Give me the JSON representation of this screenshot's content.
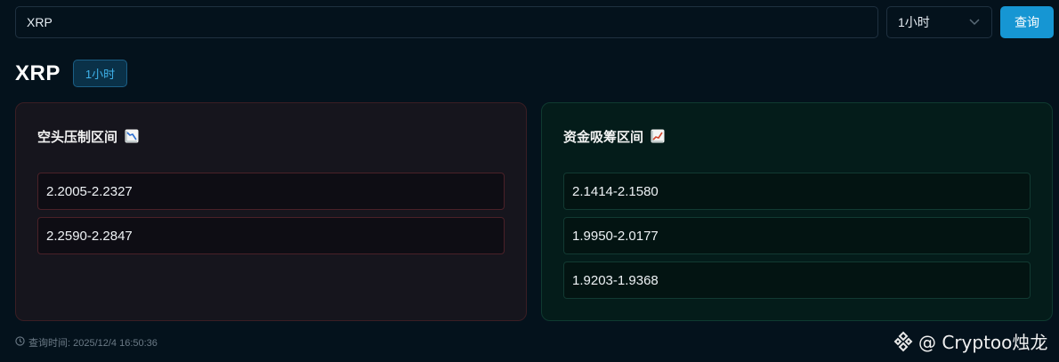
{
  "search": {
    "value": "XRP"
  },
  "timeframe_select": {
    "selected": "1小时"
  },
  "query_button": {
    "label": "查询"
  },
  "header": {
    "symbol": "XRP",
    "timeframe_badge": "1小时"
  },
  "short_card": {
    "title": "空头压制区间",
    "icon": "chart-decreasing-icon",
    "ranges": [
      "2.2005-2.2327",
      "2.2590-2.2847"
    ]
  },
  "long_card": {
    "title": "资金吸筹区间",
    "icon": "chart-increasing-icon",
    "ranges": [
      "2.1414-2.1580",
      "1.9950-2.0177",
      "1.9203-1.9368"
    ]
  },
  "footer": {
    "query_time": "查询时间: 2025/12/4 16:50:36"
  },
  "watermark": {
    "text": "@ Cryptoo烛龙"
  },
  "colors": {
    "accent": "#1696d3",
    "short_border": "#4a2128",
    "long_border": "#123a32",
    "background": "#04121c"
  }
}
